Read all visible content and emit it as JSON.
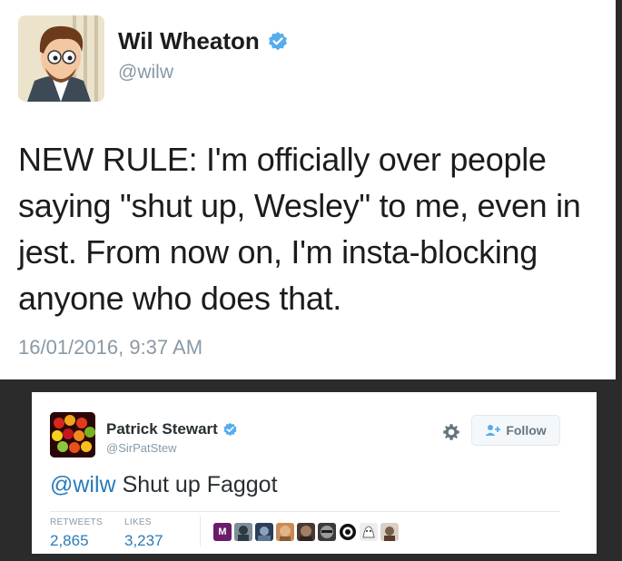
{
  "tweet1": {
    "author_name": "Wil Wheaton",
    "handle": "@wilw",
    "text": "NEW RULE: I'm officially over people saying \"shut up, Wesley\" to me, even in jest. From now on, I'm insta-blocking anyone who does that.",
    "timestamp": "16/01/2016, 9:37 AM"
  },
  "tweet2": {
    "author_name": "Patrick Stewart",
    "handle": "@SirPatStew",
    "follow_label": "Follow",
    "mention": "@wilw",
    "text": "Shut up Faggot",
    "retweets_label": "RETWEETS",
    "retweets_value": "2,865",
    "likes_label": "LIKES",
    "likes_value": "3,237",
    "liker_first_initial": "M"
  },
  "colors": {
    "verified": "#55acee",
    "link": "#2b7bb9",
    "muted": "#8899a6"
  },
  "icons": [
    "verified-badge-icon",
    "gear-icon",
    "follow-person-plus-icon"
  ]
}
